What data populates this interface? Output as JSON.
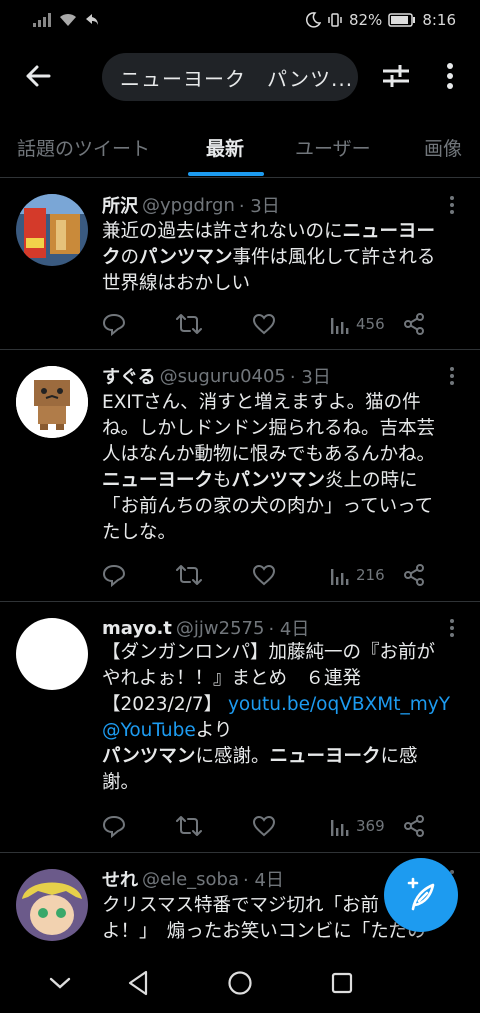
{
  "status": {
    "battery": "82%",
    "time": "8:16"
  },
  "search": {
    "query": "ニューヨーク　パンツ..."
  },
  "tabs": [
    "話題のツイート",
    "最新",
    "ユーザー",
    "画像"
  ],
  "active_tab": "最新",
  "tweets": [
    {
      "name": "所沢",
      "handle": "@ypgdrgn",
      "time": "· 3日",
      "text": [
        [
          {
            "t": "兼近の過去は許されないのに"
          },
          {
            "t": "ニューヨー",
            "hl": true
          }
        ],
        [
          {
            "t": "ク",
            "hl": true
          },
          {
            "t": "の"
          },
          {
            "t": "パンツマン",
            "hl": true
          },
          {
            "t": "事件は風化して許される"
          }
        ],
        [
          {
            "t": "世界線はおかしい"
          }
        ]
      ],
      "views": "456"
    },
    {
      "name": "すぐる",
      "handle": "@suguru0405",
      "time": "· 3日",
      "text": [
        [
          {
            "t": "EXITさん、消すと増えますよ。猫の件"
          }
        ],
        [
          {
            "t": "ね。しかしドンドン掘られるね。吉本芸"
          }
        ],
        [
          {
            "t": "人はなんか動物に恨みでもあるんかね。"
          }
        ],
        [
          {
            "t": "ニューヨーク",
            "hl": true
          },
          {
            "t": "も"
          },
          {
            "t": "パンツマン",
            "hl": true
          },
          {
            "t": "炎上の時に"
          }
        ],
        [
          {
            "t": "「お前んちの家の犬の肉か」っていって"
          }
        ],
        [
          {
            "t": "たしな。"
          }
        ]
      ],
      "views": "216"
    },
    {
      "name": "mayo.t",
      "handle": "@jjw2575",
      "time": "· 4日",
      "text": [
        [
          {
            "t": "【ダンガンロンパ】加藤純一の『お前が"
          }
        ],
        [
          {
            "t": "やれよぉ！！』まとめ　６連発"
          }
        ],
        [
          {
            "t": "【2023/2/7】 "
          },
          {
            "t": "youtu.be/oqVBXMt_myY",
            "lnk": true
          }
        ],
        [
          {
            "t": "@YouTube",
            "lnk": true
          },
          {
            "t": "より"
          }
        ],
        [
          {
            "t": "パンツマン",
            "hl": true
          },
          {
            "t": "に感謝。"
          },
          {
            "t": "ニューヨーク",
            "hl": true
          },
          {
            "t": "に感"
          }
        ],
        [
          {
            "t": "謝。"
          }
        ]
      ],
      "views": "369"
    },
    {
      "name": "せれ",
      "handle": "@ele_soba",
      "time": "· 4日",
      "text": [
        [
          {
            "t": "クリスマス特番でマジ切れ「お前"
          }
        ],
        [
          {
            "t": "よ！」　煽ったお笑いコンビに「ただの"
          }
        ]
      ],
      "views": ""
    }
  ],
  "icons": {
    "back": "arrow-left-icon",
    "filter": "sliders-icon",
    "more": "more-vertical-icon",
    "reply": "reply-icon",
    "retweet": "retweet-icon",
    "like": "heart-icon",
    "views": "views-bar-icon",
    "share": "share-icon",
    "compose": "compose-feather-icon"
  },
  "colors": {
    "accent": "#1d9bf0",
    "background": "#000000",
    "text": "#e7e9ea",
    "muted": "#71767b"
  }
}
